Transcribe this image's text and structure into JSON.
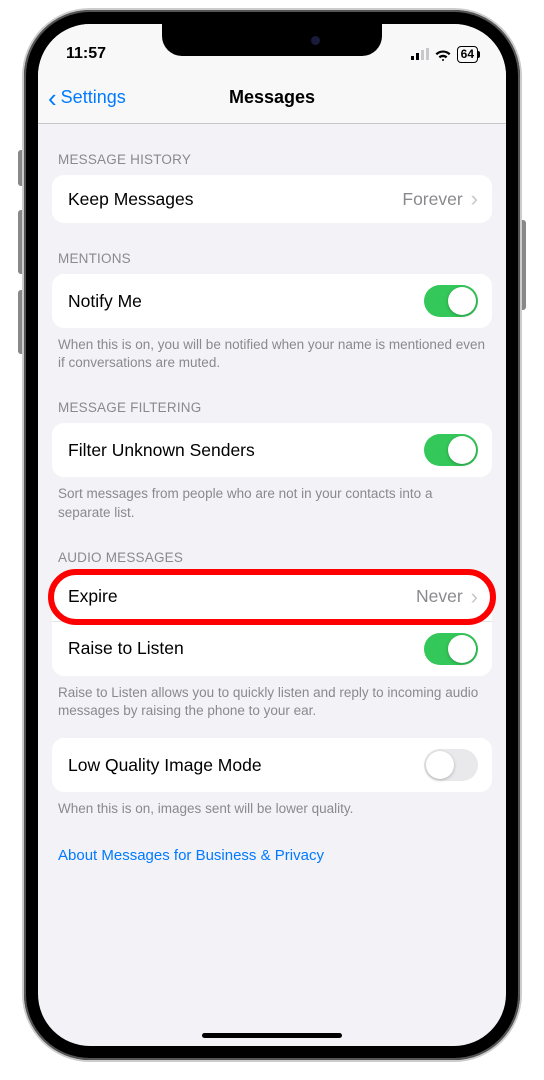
{
  "statusBar": {
    "time": "11:57",
    "battery": "64"
  },
  "nav": {
    "back": "Settings",
    "title": "Messages"
  },
  "sections": {
    "messageHistory": {
      "header": "MESSAGE HISTORY",
      "keepMessages": {
        "label": "Keep Messages",
        "value": "Forever"
      }
    },
    "mentions": {
      "header": "MENTIONS",
      "notifyMe": {
        "label": "Notify Me",
        "on": true
      },
      "footer": "When this is on, you will be notified when your name is mentioned even if conversations are muted."
    },
    "messageFiltering": {
      "header": "MESSAGE FILTERING",
      "filterUnknown": {
        "label": "Filter Unknown Senders",
        "on": true
      },
      "footer": "Sort messages from people who are not in your contacts into a separate list."
    },
    "audioMessages": {
      "header": "AUDIO MESSAGES",
      "expire": {
        "label": "Expire",
        "value": "Never"
      },
      "raiseToListen": {
        "label": "Raise to Listen",
        "on": true
      },
      "footer": "Raise to Listen allows you to quickly listen and reply to incoming audio messages by raising the phone to your ear."
    },
    "lowQuality": {
      "row": {
        "label": "Low Quality Image Mode",
        "on": false
      },
      "footer": "When this is on, images sent will be lower quality."
    }
  },
  "link": "About Messages for Business & Privacy"
}
